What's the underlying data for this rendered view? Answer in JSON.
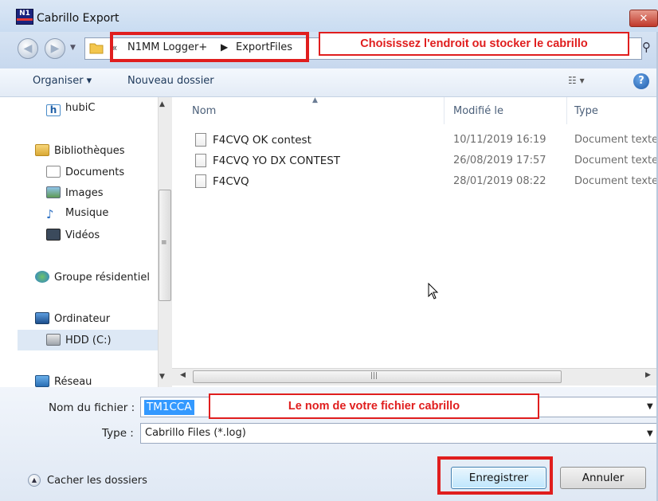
{
  "window": {
    "title": "Cabrillo Export",
    "app_icon_text": "N1",
    "close_label": "✕"
  },
  "address": {
    "crumbs": [
      "N1MM Logger+",
      "ExportFiles"
    ],
    "callout": "Choisissez l'endroit ou stocker le cabrillo"
  },
  "toolbar": {
    "organize_label": "Organiser ▾",
    "new_folder_label": "Nouveau dossier",
    "help_label": "?"
  },
  "nav": {
    "items": [
      {
        "label": "hubiC"
      },
      {
        "label": "Bibliothèques"
      },
      {
        "label": "Documents"
      },
      {
        "label": "Images"
      },
      {
        "label": "Musique"
      },
      {
        "label": "Vidéos"
      },
      {
        "label": "Groupe résidentiel"
      },
      {
        "label": "Ordinateur"
      },
      {
        "label": "HDD (C:)"
      },
      {
        "label": "Réseau"
      }
    ]
  },
  "files": {
    "columns": [
      "Nom",
      "Modifié le",
      "Type"
    ],
    "rows": [
      {
        "name": "F4CVQ OK contest",
        "date": "10/11/2019 16:19",
        "type": "Document texte"
      },
      {
        "name": "F4CVQ YO DX CONTEST",
        "date": "26/08/2019 17:57",
        "type": "Document texte"
      },
      {
        "name": "F4CVQ",
        "date": "28/01/2019 08:22",
        "type": "Document texte"
      }
    ]
  },
  "form": {
    "filename_label": "Nom du fichier :",
    "filename_value": "TM1CCA",
    "filename_callout": "Le nom de votre fichier cabrillo",
    "type_label": "Type :",
    "type_value": "Cabrillo Files (*.log)"
  },
  "footer": {
    "hide_folders_label": "Cacher les dossiers",
    "save_label": "Enregistrer",
    "cancel_label": "Annuler"
  },
  "colors": {
    "highlight_red": "#e01e1e",
    "selection_blue": "#3399ff"
  }
}
